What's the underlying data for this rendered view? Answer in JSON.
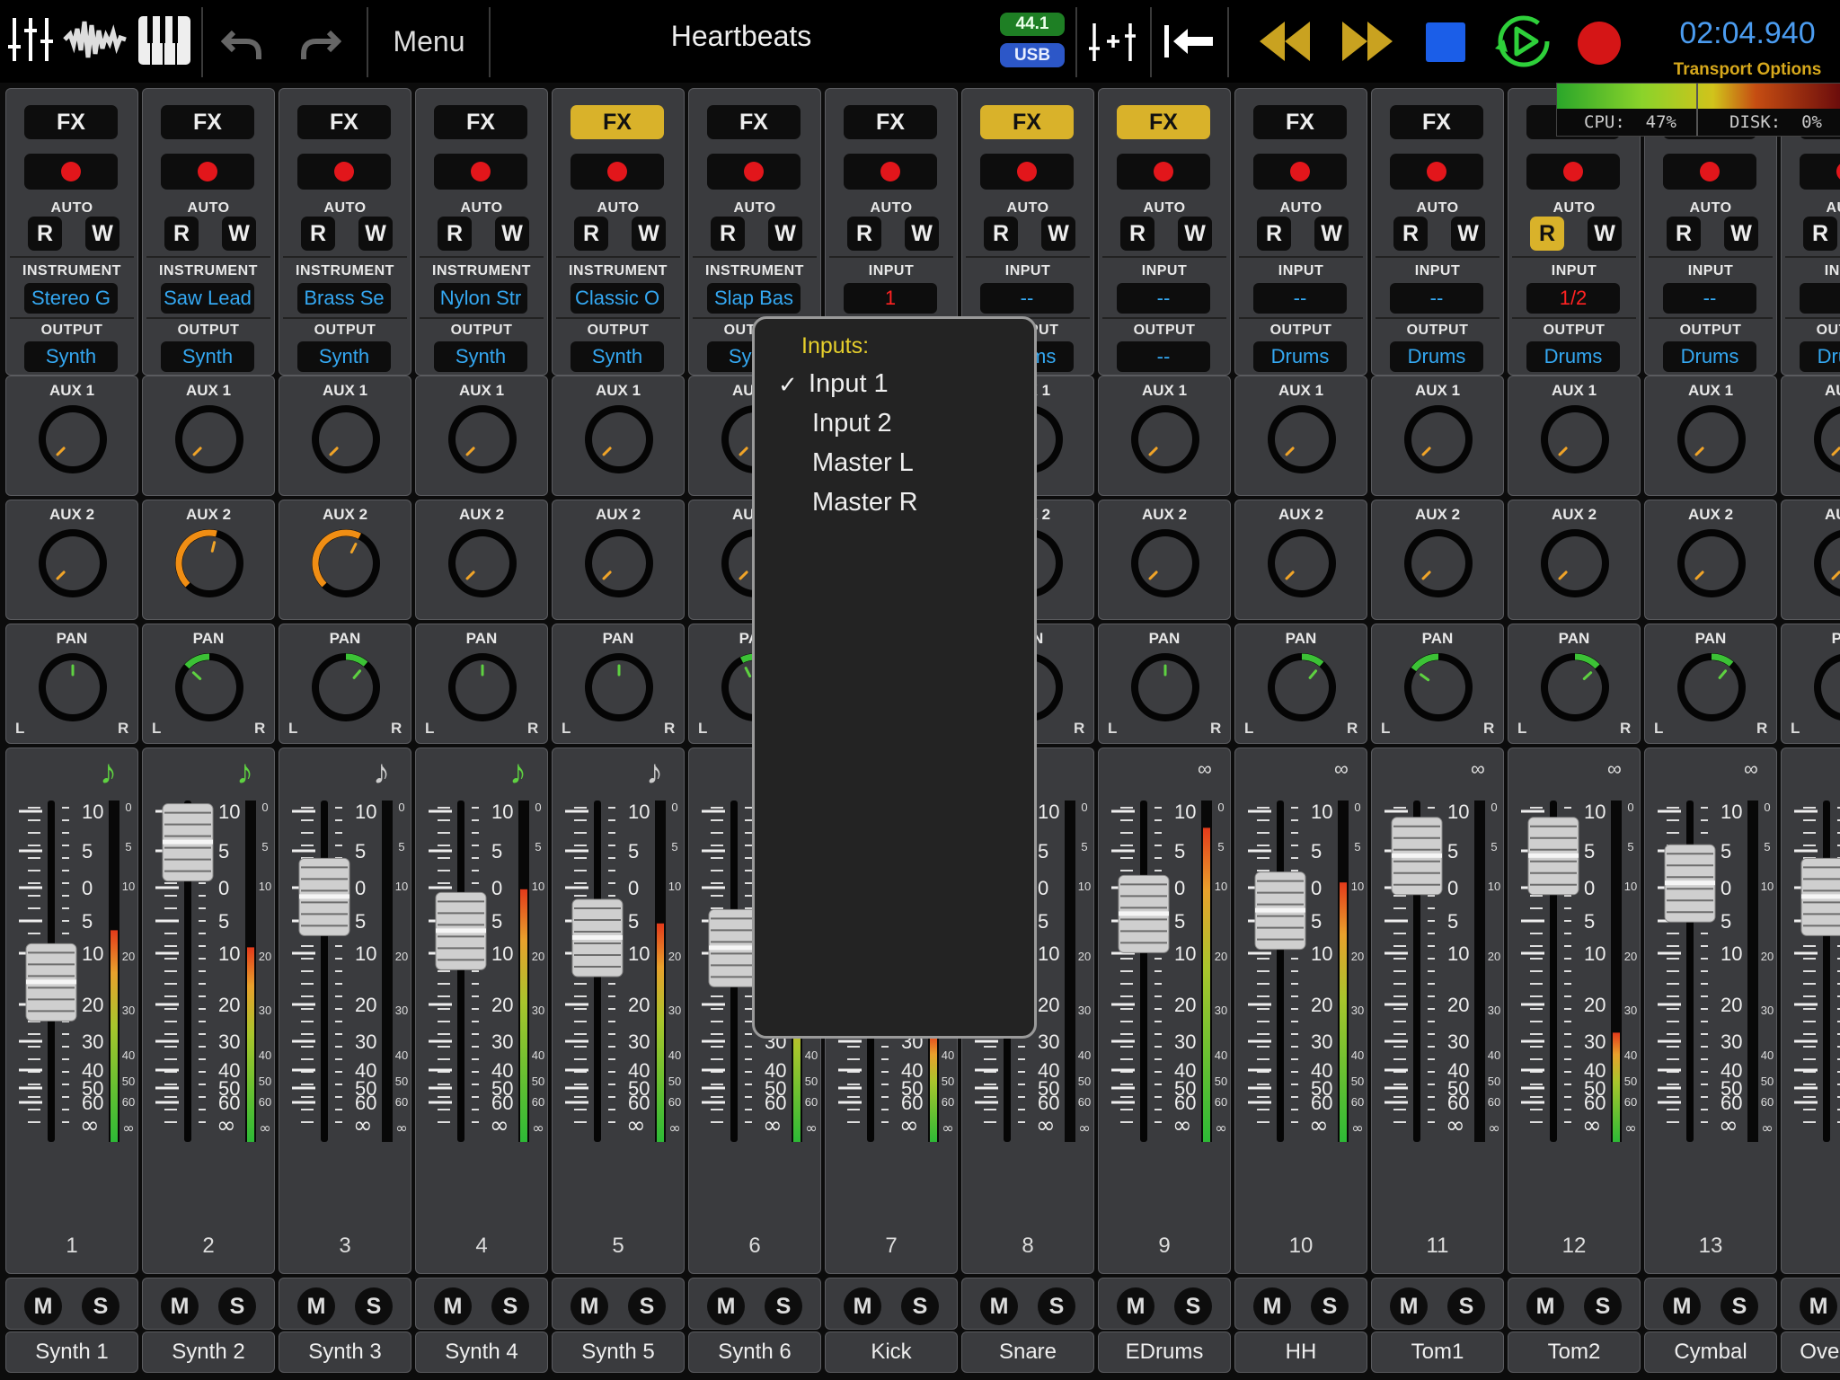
{
  "topbar": {
    "menu_label": "Menu",
    "song_title": "Heartbeats",
    "sample_rate": "44.1",
    "interface": "USB",
    "time": "02:04.940",
    "transport_options": "Transport Options",
    "cpu": "CPU:  47%",
    "disk": "DISK:  0%",
    "icons": [
      "mixer-icon",
      "waveform-icon",
      "piano-icon",
      "undo-icon",
      "redo-icon",
      "tracks-icon",
      "rewind-to-start-icon",
      "rewind-icon",
      "fast-forward-icon",
      "stop-icon",
      "play-loop-icon",
      "record-icon"
    ]
  },
  "colors": {
    "accent_blue": "#34a8f2",
    "gold": "#d9b22a",
    "record_red": "#e2161b",
    "meter_green": "#3cc236"
  },
  "labels": {
    "auto": "AUTO",
    "instrument": "INSTRUMENT",
    "input": "INPUT",
    "output": "OUTPUT",
    "aux1": "AUX 1",
    "aux2": "AUX 2",
    "pan": "PAN",
    "l": "L",
    "r": "R",
    "fx": "FX",
    "read": "R",
    "write": "W",
    "mute": "M",
    "solo": "S"
  },
  "popup": {
    "title": "Inputs:",
    "options": [
      "Input 1",
      "Input 2",
      "Master L",
      "Master R"
    ],
    "selected": "Input 1"
  },
  "strips": [
    {
      "num": "1",
      "name": "Synth 1",
      "kind": "INSTRUMENT",
      "src": "Stereo G",
      "out": "Synth",
      "fx": false,
      "r": false,
      "note": "green",
      "fader": 0.47,
      "meter": 0.62,
      "aux2": 0,
      "pan": 0
    },
    {
      "num": "2",
      "name": "Synth 2",
      "kind": "INSTRUMENT",
      "src": "Saw Lead",
      "out": "Synth",
      "fx": false,
      "r": false,
      "note": "green",
      "fader": 0.88,
      "meter": 0.57,
      "aux2": 0.55,
      "pan": -0.35
    },
    {
      "num": "3",
      "name": "Synth 3",
      "kind": "INSTRUMENT",
      "src": "Brass Se",
      "out": "Synth",
      "fx": false,
      "r": false,
      "note": "grey",
      "fader": 0.72,
      "meter": 0,
      "aux2": 0.6,
      "pan": 0.3
    },
    {
      "num": "4",
      "name": "Synth 4",
      "kind": "INSTRUMENT",
      "src": "Nylon Str",
      "out": "Synth",
      "fx": false,
      "r": false,
      "note": "green",
      "fader": 0.62,
      "meter": 0.74,
      "aux2": 0,
      "pan": 0
    },
    {
      "num": "5",
      "name": "Synth 5",
      "kind": "INSTRUMENT",
      "src": "Classic O",
      "out": "Synth",
      "fx": true,
      "r": false,
      "note": "grey",
      "fader": 0.6,
      "meter": 0.64,
      "aux2": 0,
      "pan": 0
    },
    {
      "num": "6",
      "name": "Synth 6",
      "kind": "INSTRUMENT",
      "src": "Slap Bas",
      "out": "Synth",
      "fx": false,
      "r": false,
      "note": "",
      "fader": 0.57,
      "meter": 0.5,
      "aux2": 0,
      "pan": -0.2
    },
    {
      "num": "7",
      "name": "Kick",
      "kind": "INPUT",
      "src": "1",
      "out": "Drums",
      "fx": false,
      "r": false,
      "note": "",
      "fader": 0.5,
      "meter": 0.32,
      "aux2": 0,
      "pan": 0
    },
    {
      "num": "8",
      "name": "Snare",
      "kind": "INPUT",
      "src": "--",
      "out": "Drums",
      "fx": true,
      "r": false,
      "note": "",
      "fader": 0.5,
      "meter": 0,
      "aux2": 0,
      "pan": 0
    },
    {
      "num": "9",
      "name": "EDrums",
      "kind": "INPUT",
      "src": "--",
      "out": "--",
      "fx": true,
      "r": false,
      "note": "link",
      "fader": 0.67,
      "meter": 0.92,
      "aux2": 0,
      "pan": 0
    },
    {
      "num": "10",
      "name": "HH",
      "kind": "INPUT",
      "src": "--",
      "out": "Drums",
      "fx": false,
      "r": false,
      "note": "link",
      "fader": 0.68,
      "meter": 0.76,
      "aux2": 0,
      "pan": 0.3
    },
    {
      "num": "11",
      "name": "Tom1",
      "kind": "INPUT",
      "src": "--",
      "out": "Drums",
      "fx": false,
      "r": false,
      "note": "link",
      "fader": 0.84,
      "meter": 0,
      "aux2": 0,
      "pan": -0.4
    },
    {
      "num": "12",
      "name": "Tom2",
      "kind": "INPUT",
      "src": "1/2",
      "out": "Drums",
      "fx": false,
      "r": true,
      "note": "link",
      "fader": 0.84,
      "meter": 0.32,
      "aux2": 0,
      "pan": 0.35
    },
    {
      "num": "13",
      "name": "Cymbal",
      "kind": "INPUT",
      "src": "--",
      "out": "Drums",
      "fx": false,
      "r": false,
      "note": "link",
      "fader": 0.76,
      "meter": 0,
      "aux2": 0,
      "pan": 0.3
    },
    {
      "num": "",
      "name": "Overhead",
      "kind": "INPUT",
      "src": "--",
      "out": "Drums",
      "fx": false,
      "r": false,
      "note": "",
      "fader": 0.72,
      "meter": 0,
      "aux2": 0,
      "pan": 0
    }
  ]
}
